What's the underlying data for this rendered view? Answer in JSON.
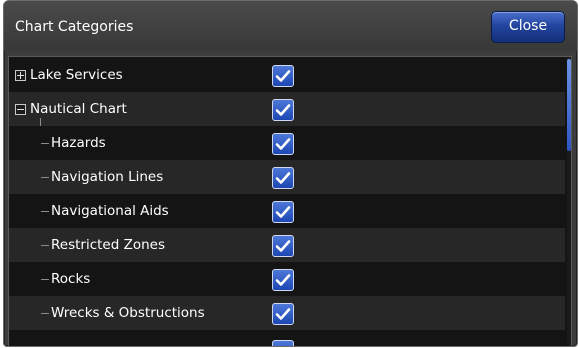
{
  "dialog": {
    "title": "Chart Categories",
    "close_label": "Close"
  },
  "list": {
    "rows": [
      {
        "label": "Lake Services",
        "checked": true,
        "expander": "plus",
        "level": 0
      },
      {
        "label": "Nautical Chart",
        "checked": true,
        "expander": "minus",
        "level": 0
      },
      {
        "label": "Hazards",
        "checked": true,
        "level": 1
      },
      {
        "label": "Navigation Lines",
        "checked": true,
        "level": 1
      },
      {
        "label": "Navigational Aids",
        "checked": true,
        "level": 1
      },
      {
        "label": "Restricted Zones",
        "checked": true,
        "level": 1
      },
      {
        "label": "Rocks",
        "checked": true,
        "level": 1
      },
      {
        "label": "Wrecks & Obstructions",
        "checked": true,
        "level": 1
      }
    ]
  },
  "icons": {
    "checkbox_checked": "checkmark-icon",
    "expand": "plus-box-icon",
    "collapse": "minus-box-icon"
  },
  "colors": {
    "accent_blue": "#2a55c0",
    "panel_dark": "#141414",
    "row_alt": "#272727",
    "title_bg": "#3c3c3c"
  }
}
